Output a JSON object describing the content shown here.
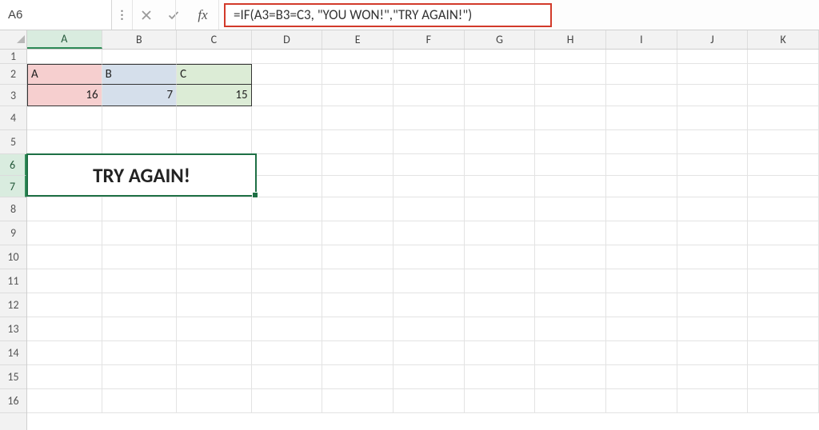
{
  "formulaBar": {
    "nameBox": "A6",
    "fxLabel": "fx",
    "formula": "=IF(A3=B3=C3, \"YOU WON!\",\"TRY AGAIN!\")"
  },
  "columns": [
    "A",
    "B",
    "C",
    "D",
    "E",
    "F",
    "G",
    "H",
    "I",
    "J",
    "K"
  ],
  "rows": [
    "1",
    "2",
    "3",
    "4",
    "5",
    "6",
    "7",
    "8",
    "9",
    "10",
    "11",
    "12",
    "13",
    "14",
    "15",
    "16"
  ],
  "selectedCol": "A",
  "selectedRows": [
    "6",
    "7"
  ],
  "headerRow": {
    "A": "A",
    "B": "B",
    "C": "C"
  },
  "valueRow": {
    "A": "16",
    "B": "7",
    "C": "15"
  },
  "resultCell": "TRY AGAIN!",
  "colors": {
    "selectAccent": "#1e7045",
    "pink": "#f6cfcf",
    "blue": "#d5dfeb",
    "green": "#dcecd6",
    "highlightBorder": "#d23a2a"
  }
}
